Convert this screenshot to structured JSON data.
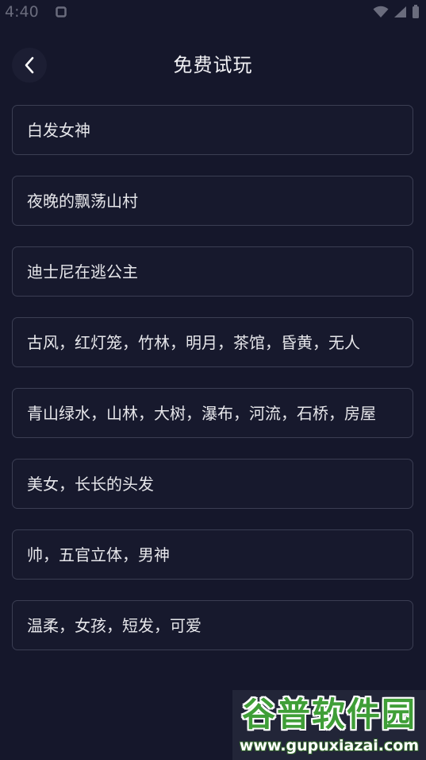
{
  "status_bar": {
    "time": "4:40"
  },
  "header": {
    "title": "免费试玩"
  },
  "items": [
    {
      "label": "白发女神"
    },
    {
      "label": "夜晚的飘荡山村"
    },
    {
      "label": "迪士尼在逃公主"
    },
    {
      "label": "古风，红灯笼，竹林，明月，茶馆，昏黄，无人"
    },
    {
      "label": "青山绿水，山林，大树，瀑布，河流，石桥，房屋"
    },
    {
      "label": "美女，长长的头发"
    },
    {
      "label": "帅，五官立体，男神"
    },
    {
      "label": "温柔，女孩，短发，可爱"
    }
  ],
  "watermark": {
    "name": "谷普软件园",
    "url": "www.gupuxiazai.com"
  },
  "icons": {
    "back": "chevron-left-icon",
    "notification": "notification-square-icon",
    "wifi": "wifi-icon",
    "signal": "signal-icon",
    "battery": "battery-icon"
  },
  "colors": {
    "background": "#15172b",
    "item_border": "#3b3e53",
    "item_text": "#e6e6ea",
    "title_text": "#f2f2f5",
    "watermark_green": "#3f9e37"
  }
}
